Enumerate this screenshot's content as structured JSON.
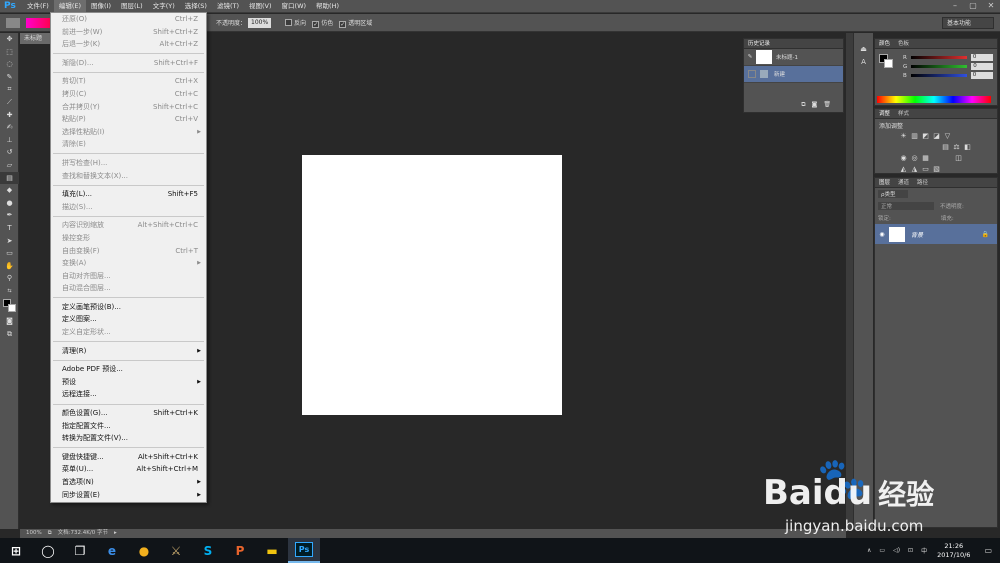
{
  "app": {
    "logo": "Ps",
    "menus": [
      "文件(F)",
      "编辑(E)",
      "图像(I)",
      "图层(L)",
      "文字(Y)",
      "选择(S)",
      "滤镜(T)",
      "视图(V)",
      "窗口(W)",
      "帮助(H)"
    ],
    "window_controls": [
      "–",
      "▢",
      "✕"
    ]
  },
  "options": {
    "mode_label": "模式：",
    "mode_value": "正常",
    "opacity_label": "不透明度：",
    "opacity_value": "100%",
    "reverse_label": "反向",
    "dither_label": "仿色",
    "transparency_label": "透明区域",
    "workspace": "基本功能"
  },
  "document": {
    "tab_label": "未标题"
  },
  "status": {
    "zoom": "100%",
    "doc_info": "文档:732.4K/0 字节"
  },
  "history": {
    "tabs": [
      "历史记录"
    ],
    "snapshot_name": "未标题-1",
    "step": "新建"
  },
  "color": {
    "tabs": [
      "颜色",
      "色板"
    ],
    "channels": [
      {
        "label": "R",
        "value": "0",
        "color": "#e03030"
      },
      {
        "label": "G",
        "value": "0",
        "color": "#30c030"
      },
      {
        "label": "B",
        "value": "0",
        "color": "#3050e0"
      }
    ]
  },
  "adjustments": {
    "tabs": [
      "调整",
      "样式"
    ],
    "title": "添加调整"
  },
  "layers": {
    "tabs": [
      "图层",
      "通道",
      "路径"
    ],
    "kind": "ρ类型",
    "blend": "正常",
    "opacity_label": "不透明度:",
    "lock_label": "锁定:",
    "fill_label": "填充:",
    "layer_name": "背景"
  },
  "edit_menu": {
    "items": [
      {
        "label": "还原(O)",
        "shortcut": "Ctrl+Z",
        "disabled": true
      },
      {
        "label": "前进一步(W)",
        "shortcut": "Shift+Ctrl+Z",
        "disabled": true
      },
      {
        "label": "后退一步(K)",
        "shortcut": "Alt+Ctrl+Z",
        "disabled": true
      },
      {
        "sep": true
      },
      {
        "label": "渐隐(D)...",
        "shortcut": "Shift+Ctrl+F",
        "disabled": true
      },
      {
        "sep": true
      },
      {
        "label": "剪切(T)",
        "shortcut": "Ctrl+X",
        "disabled": true
      },
      {
        "label": "拷贝(C)",
        "shortcut": "Ctrl+C",
        "disabled": true
      },
      {
        "label": "合并拷贝(Y)",
        "shortcut": "Shift+Ctrl+C",
        "disabled": true
      },
      {
        "label": "粘贴(P)",
        "shortcut": "Ctrl+V",
        "disabled": true
      },
      {
        "label": "选择性粘贴(I)",
        "shortcut": "",
        "disabled": true,
        "submenu": true
      },
      {
        "label": "清除(E)",
        "shortcut": "",
        "disabled": true
      },
      {
        "sep": true
      },
      {
        "label": "拼写检查(H)...",
        "shortcut": "",
        "disabled": true
      },
      {
        "label": "查找和替换文本(X)...",
        "shortcut": "",
        "disabled": true
      },
      {
        "sep": true
      },
      {
        "label": "填充(L)...",
        "shortcut": "Shift+F5",
        "disabled": false
      },
      {
        "label": "描边(S)...",
        "shortcut": "",
        "disabled": true
      },
      {
        "sep": true
      },
      {
        "label": "内容识别缩放",
        "shortcut": "Alt+Shift+Ctrl+C",
        "disabled": true
      },
      {
        "label": "操控变形",
        "shortcut": "",
        "disabled": true
      },
      {
        "label": "自由变换(F)",
        "shortcut": "Ctrl+T",
        "disabled": true
      },
      {
        "label": "变换(A)",
        "shortcut": "",
        "disabled": true,
        "submenu": true
      },
      {
        "label": "自动对齐图层...",
        "shortcut": "",
        "disabled": true
      },
      {
        "label": "自动混合图层...",
        "shortcut": "",
        "disabled": true
      },
      {
        "sep": true
      },
      {
        "label": "定义画笔预设(B)...",
        "shortcut": "",
        "disabled": false
      },
      {
        "label": "定义图案...",
        "shortcut": "",
        "disabled": false
      },
      {
        "label": "定义自定形状...",
        "shortcut": "",
        "disabled": true
      },
      {
        "sep": true
      },
      {
        "label": "清理(R)",
        "shortcut": "",
        "disabled": false,
        "submenu": true
      },
      {
        "sep": true
      },
      {
        "label": "Adobe PDF 预设...",
        "shortcut": "",
        "disabled": false
      },
      {
        "label": "预设",
        "shortcut": "",
        "disabled": false,
        "submenu": true
      },
      {
        "label": "远程连接...",
        "shortcut": "",
        "disabled": false
      },
      {
        "sep": true
      },
      {
        "label": "颜色设置(G)...",
        "shortcut": "Shift+Ctrl+K",
        "disabled": false
      },
      {
        "label": "指定配置文件...",
        "shortcut": "",
        "disabled": false
      },
      {
        "label": "转换为配置文件(V)...",
        "shortcut": "",
        "disabled": false
      },
      {
        "sep": true
      },
      {
        "label": "键盘快捷键...",
        "shortcut": "Alt+Shift+Ctrl+K",
        "disabled": false
      },
      {
        "label": "菜单(U)...",
        "shortcut": "Alt+Shift+Ctrl+M",
        "disabled": false
      },
      {
        "label": "首选项(N)",
        "shortcut": "",
        "disabled": false,
        "submenu": true
      },
      {
        "label": "同步设置(E)",
        "shortcut": "",
        "disabled": false,
        "submenu": true
      }
    ]
  },
  "taskbar": {
    "apps": [
      {
        "name": "start-button",
        "glyph": "⊞"
      },
      {
        "name": "cortana-button",
        "glyph": "◯"
      },
      {
        "name": "task-view-button",
        "glyph": "❐"
      },
      {
        "name": "edge-app",
        "glyph": "e"
      },
      {
        "name": "ie-app",
        "glyph": "●"
      },
      {
        "name": "lol-app",
        "glyph": "⚔"
      },
      {
        "name": "skype-app",
        "glyph": "S"
      },
      {
        "name": "wps-app",
        "glyph": "P"
      },
      {
        "name": "explorer-app",
        "glyph": "▬"
      },
      {
        "name": "photoshop-app",
        "glyph": "Ps"
      }
    ],
    "time": "21:26",
    "date": "2017/10/6",
    "ime": "中",
    "tray_glyphs": [
      "∧",
      "▭",
      "◁)",
      "⊡",
      "中"
    ]
  },
  "watermark": {
    "brand": "Bai",
    "brand2": "du",
    "cn": "经验",
    "url": "jingyan.baidu.com"
  }
}
